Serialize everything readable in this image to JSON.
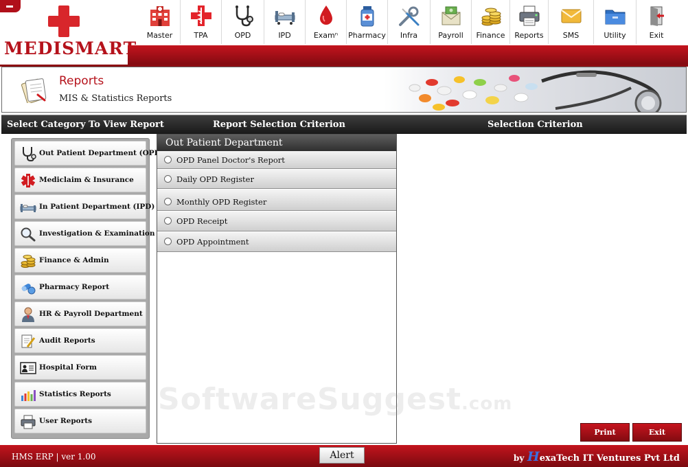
{
  "app": {
    "logo_text": "MEDISMART"
  },
  "nav": [
    {
      "label": "Master",
      "icon": "hospital-building-icon"
    },
    {
      "label": "TPA",
      "icon": "red-cross-caduceus-icon"
    },
    {
      "label": "OPD",
      "icon": "stethoscope-icon"
    },
    {
      "label": "IPD",
      "icon": "hospital-bed-icon"
    },
    {
      "label": "Examⁿ",
      "icon": "blood-drop-icon"
    },
    {
      "label": "Pharmacy",
      "icon": "medicine-bottle-icon"
    },
    {
      "label": "Infra",
      "icon": "wrench-screwdriver-icon"
    },
    {
      "label": "Payroll",
      "icon": "money-envelope-icon"
    },
    {
      "label": "Finance",
      "icon": "coin-stack-icon"
    },
    {
      "label": "Reports",
      "icon": "printer-icon"
    },
    {
      "label": "SMS",
      "icon": "envelope-icon"
    },
    {
      "label": "Utility",
      "icon": "folder-icon"
    },
    {
      "label": "Exit",
      "icon": "exit-door-icon"
    }
  ],
  "banner": {
    "title": "Reports",
    "subtitle": "MIS & Statistics Reports"
  },
  "section_header": {
    "col1": "Select Category To View Report",
    "col2": "Report Selection Criterion",
    "col3": "Selection Criterion"
  },
  "categories": [
    {
      "label": "Out Patient Department (OPD)",
      "icon": "stethoscope-icon"
    },
    {
      "label": "Mediclaim & Insurance",
      "icon": "medical-star-icon"
    },
    {
      "label": "In Patient Department (IPD)",
      "icon": "hospital-bed-icon"
    },
    {
      "label": "Investigation & Examination",
      "icon": "magnifier-icon"
    },
    {
      "label": "Finance & Admin",
      "icon": "coin-stack-icon"
    },
    {
      "label": "Pharmacy Report",
      "icon": "pills-icon"
    },
    {
      "label": "HR & Payroll Department",
      "icon": "person-icon"
    },
    {
      "label": "Audit Reports",
      "icon": "document-pencil-icon"
    },
    {
      "label": "Hospital Form",
      "icon": "id-card-icon"
    },
    {
      "label": "Statistics Reports",
      "icon": "bar-chart-icon"
    },
    {
      "label": "User Reports",
      "icon": "printer-icon"
    }
  ],
  "report_panel": {
    "title": "Out Patient Department",
    "items": [
      {
        "label": "OPD Panel Doctor's Report"
      },
      {
        "label": "Daily OPD Register"
      },
      {
        "label": "Monthly OPD Register"
      },
      {
        "label": "OPD Receipt"
      },
      {
        "label": "OPD Appointment"
      }
    ]
  },
  "watermark": {
    "main": "SoftwareSuggest",
    "suffix": ".com"
  },
  "actions": {
    "print_label": "Print",
    "exit_label": "Exit"
  },
  "footer": {
    "version": "HMS ERP  |  ver 1.00",
    "alert_label": "Alert",
    "credit_by": "by",
    "credit_h": "H",
    "credit_rest": "exaTech IT Ventures Pvt Ltd"
  },
  "colors": {
    "brand_red": "#b5121b",
    "dark_header": "#2a2a2a",
    "panel_gray": "#a9a9a9"
  }
}
